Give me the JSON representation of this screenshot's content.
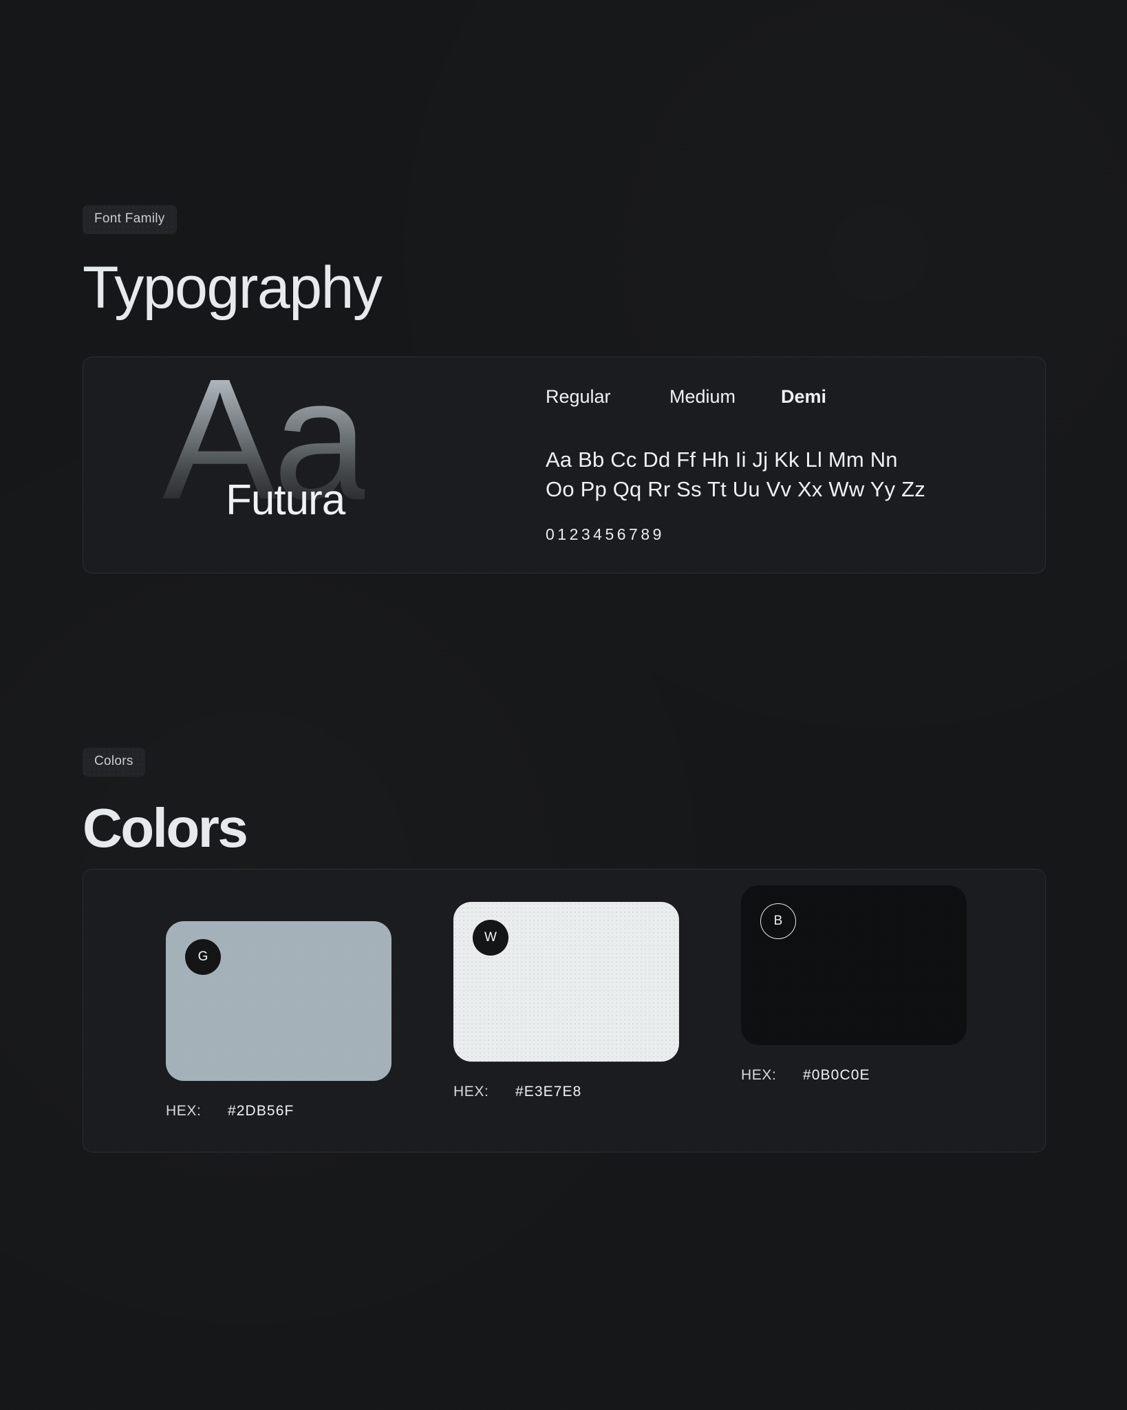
{
  "typography": {
    "badge": "Font Family",
    "title": "Typography",
    "font_name": "Futura",
    "glyph_sample": "Aa",
    "weights": [
      {
        "label": "Regular"
      },
      {
        "label": "Medium"
      },
      {
        "label": "Demi"
      }
    ],
    "alphabet_line_1": "Aa Bb Cc Dd Ff Hh Ii Jj Kk Ll Mm Nn",
    "alphabet_line_2": "Oo Pp Qq Rr Ss Tt Uu Vv Xx Ww Yy Zz",
    "numerals": "0123456789"
  },
  "colors": {
    "badge": "Colors",
    "title": "Colors",
    "hex_label": "HEX:",
    "swatches": [
      {
        "initial": "G",
        "hex": "#2DB56F",
        "fill": "#A4B1B8",
        "chip_style": "filled"
      },
      {
        "initial": "W",
        "hex": "#E3E7E8",
        "fill": "#E9EDEE",
        "chip_style": "filled"
      },
      {
        "initial": "B",
        "hex": "#0B0C0E",
        "fill": "#0E0F11",
        "chip_style": "outline"
      }
    ]
  }
}
